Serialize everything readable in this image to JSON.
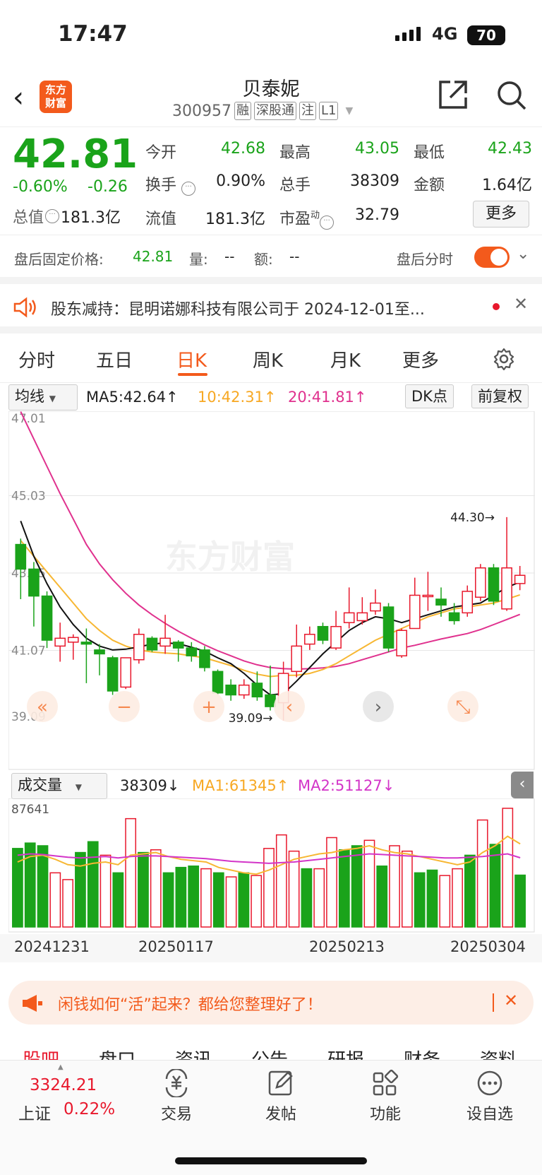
{
  "status": {
    "time": "17:47",
    "network": "4G",
    "battery": "70"
  },
  "header": {
    "logo": "东方\n财富",
    "title": "贝泰妮",
    "code": "300957",
    "tags": [
      "融",
      "深股通",
      "注",
      "L1"
    ]
  },
  "quote": {
    "price": "42.81",
    "pct": "-0.60%",
    "change": "-0.26",
    "open_l": "今开",
    "open_v": "42.68",
    "high_l": "最高",
    "high_v": "43.05",
    "low_l": "最低",
    "low_v": "42.43",
    "turn_l": "换手",
    "turn_v": "0.90%",
    "vol_l": "总手",
    "vol_v": "38309",
    "amt_l": "金额",
    "amt_v": "1.64亿",
    "mcap_l": "总值",
    "mcap_v": "181.3亿",
    "fcap_l": "流值",
    "fcap_v": "181.3亿",
    "pe_l": "市盈",
    "pe_sup": "动",
    "pe_v": "32.79",
    "more": "更多"
  },
  "after": {
    "label": "盘后固定价格:",
    "price": "42.81",
    "vol_l": "量:",
    "vol_v": "--",
    "amt_l": "额:",
    "amt_v": "--",
    "toggle_l": "盘后分时"
  },
  "notice": {
    "text": "股东减持：昆明诺娜科技有限公司于 2024-12-01至..."
  },
  "tabs": [
    "分时",
    "五日",
    "日K",
    "周K",
    "月K",
    "更多"
  ],
  "ktool": {
    "select": "均线",
    "ma5": "MA5:42.64↑",
    "ma10": "10:42.31↑",
    "ma20": "20:41.81↑",
    "dk": "DK点",
    "fq": "前复权"
  },
  "vtool": {
    "select": "成交量",
    "vol": "38309↓",
    "ma1": "MA1:61345↑",
    "ma2": "MA2:51127↓",
    "vmax": "87641"
  },
  "chart_data": {
    "type": "candlestick",
    "ylim": [
      39.09,
      47.01
    ],
    "yticks": [
      "47.01",
      "45.03",
      "43.05",
      "41.07",
      "39.09"
    ],
    "high_mark": "44.30",
    "low_mark": "39.09",
    "candles": [
      {
        "o": 43.6,
        "c": 42.97,
        "h": 43.75,
        "l": 42.2
      },
      {
        "o": 42.97,
        "c": 42.28,
        "h": 43.15,
        "l": 41.5
      },
      {
        "o": 42.28,
        "c": 41.15,
        "h": 42.4,
        "l": 40.95
      },
      {
        "o": 41.0,
        "c": 41.2,
        "h": 41.6,
        "l": 40.6
      },
      {
        "o": 41.1,
        "c": 41.22,
        "h": 41.3,
        "l": 40.65
      },
      {
        "o": 41.1,
        "c": 41.05,
        "h": 41.45,
        "l": 40.05
      },
      {
        "o": 40.9,
        "c": 40.8,
        "h": 41.05,
        "l": 40.25
      },
      {
        "o": 40.7,
        "c": 39.85,
        "h": 40.75,
        "l": 39.75
      },
      {
        "o": 39.95,
        "c": 40.7,
        "h": 40.7,
        "l": 39.9
      },
      {
        "o": 40.65,
        "c": 41.3,
        "h": 41.45,
        "l": 40.55
      },
      {
        "o": 41.2,
        "c": 40.9,
        "h": 41.25,
        "l": 40.85
      },
      {
        "o": 41.0,
        "c": 41.2,
        "h": 41.8,
        "l": 40.8
      },
      {
        "o": 41.1,
        "c": 40.95,
        "h": 41.15,
        "l": 40.6
      },
      {
        "o": 40.95,
        "c": 40.75,
        "h": 41.1,
        "l": 40.6
      },
      {
        "o": 40.9,
        "c": 40.45,
        "h": 41.0,
        "l": 40.35
      },
      {
        "o": 40.35,
        "c": 39.8,
        "h": 40.4,
        "l": 39.75
      },
      {
        "o": 40.0,
        "c": 39.75,
        "h": 40.15,
        "l": 39.6
      },
      {
        "o": 39.75,
        "c": 40.0,
        "h": 40.15,
        "l": 39.65
      },
      {
        "o": 40.05,
        "c": 39.7,
        "h": 40.35,
        "l": 39.6
      },
      {
        "o": 39.75,
        "c": 39.45,
        "h": 40.5,
        "l": 39.35
      },
      {
        "o": 39.55,
        "c": 40.3,
        "h": 40.6,
        "l": 39.09
      },
      {
        "o": 40.35,
        "c": 41.0,
        "h": 41.55,
        "l": 40.2
      },
      {
        "o": 41.05,
        "c": 41.3,
        "h": 41.5,
        "l": 40.9
      },
      {
        "o": 41.5,
        "c": 41.15,
        "h": 41.6,
        "l": 41.05
      },
      {
        "o": 40.95,
        "c": 41.5,
        "h": 41.9,
        "l": 40.9
      },
      {
        "o": 41.6,
        "c": 41.85,
        "h": 42.5,
        "l": 41.45
      },
      {
        "o": 41.65,
        "c": 41.85,
        "h": 42.25,
        "l": 41.55
      },
      {
        "o": 41.9,
        "c": 42.1,
        "h": 42.45,
        "l": 41.8
      },
      {
        "o": 42.0,
        "c": 40.95,
        "h": 42.1,
        "l": 40.85
      },
      {
        "o": 40.75,
        "c": 41.4,
        "h": 41.45,
        "l": 40.7
      },
      {
        "o": 41.45,
        "c": 42.3,
        "h": 42.75,
        "l": 41.45
      },
      {
        "o": 42.3,
        "c": 42.3,
        "h": 42.9,
        "l": 41.9
      },
      {
        "o": 42.2,
        "c": 42.05,
        "h": 42.5,
        "l": 41.75
      },
      {
        "o": 41.85,
        "c": 41.65,
        "h": 42.1,
        "l": 41.55
      },
      {
        "o": 41.85,
        "c": 42.4,
        "h": 42.55,
        "l": 41.75
      },
      {
        "o": 42.25,
        "c": 43.0,
        "h": 43.1,
        "l": 42.15
      },
      {
        "o": 43.0,
        "c": 42.15,
        "h": 43.1,
        "l": 42.05
      },
      {
        "o": 41.95,
        "c": 43.0,
        "h": 44.3,
        "l": 41.9
      },
      {
        "o": 42.6,
        "c": 42.81,
        "h": 43.05,
        "l": 42.43
      }
    ],
    "ma5": [
      44.2,
      43.3,
      42.6,
      42.0,
      41.55,
      41.2,
      41.0,
      40.9,
      40.92,
      40.98,
      41.05,
      41.08,
      41.06,
      40.97,
      40.87,
      40.7,
      40.55,
      40.3,
      40.0,
      39.75,
      39.78,
      40.1,
      40.45,
      40.8,
      41.1,
      41.4,
      41.6,
      41.75,
      41.7,
      41.6,
      41.7,
      41.8,
      41.9,
      42.0,
      42.05,
      42.1,
      42.3,
      42.5,
      42.64
    ],
    "ma10": [
      43.7,
      43.3,
      42.9,
      42.5,
      42.1,
      41.7,
      41.4,
      41.15,
      41.0,
      40.9,
      40.85,
      40.82,
      40.8,
      40.75,
      40.7,
      40.6,
      40.5,
      40.38,
      40.28,
      40.22,
      40.25,
      40.25,
      40.3,
      40.4,
      40.55,
      40.75,
      40.95,
      41.15,
      41.3,
      41.45,
      41.6,
      41.75,
      41.85,
      41.95,
      42.0,
      42.05,
      42.1,
      42.2,
      42.31
    ],
    "ma20": [
      47.0,
      46.3,
      45.6,
      44.9,
      44.25,
      43.6,
      43.1,
      42.7,
      42.35,
      42.05,
      41.8,
      41.58,
      41.38,
      41.2,
      41.03,
      40.88,
      40.75,
      40.62,
      40.52,
      40.45,
      40.42,
      40.41,
      40.42,
      40.44,
      40.48,
      40.55,
      40.65,
      40.75,
      40.85,
      40.95,
      41.02,
      41.1,
      41.18,
      41.25,
      41.32,
      41.42,
      41.55,
      41.68,
      41.81
    ],
    "volumes": [
      58000,
      62000,
      60000,
      40000,
      35000,
      55000,
      63000,
      53000,
      40000,
      80000,
      55000,
      57000,
      40000,
      44000,
      45000,
      43000,
      40000,
      37000,
      40000,
      38000,
      58000,
      68000,
      56000,
      43000,
      43000,
      66000,
      57000,
      60000,
      64000,
      45000,
      60000,
      56000,
      40000,
      42000,
      38000,
      43000,
      53000,
      79000,
      61000,
      87641,
      38309
    ],
    "vol_up": [
      false,
      false,
      false,
      true,
      true,
      false,
      false,
      true,
      false,
      true,
      false,
      true,
      false,
      false,
      false,
      true,
      false,
      true,
      false,
      true,
      true,
      true,
      true,
      false,
      true,
      true,
      false,
      false,
      true,
      false,
      true,
      true,
      false,
      false,
      true,
      true,
      false,
      true,
      false,
      true,
      false
    ],
    "vma1": [
      48000,
      52000,
      53000,
      50000,
      46000,
      45000,
      47000,
      48000,
      46000,
      53000,
      54000,
      55000,
      52000,
      50000,
      49000,
      48000,
      44000,
      42000,
      40000,
      39000,
      42000,
      46000,
      50000,
      52000,
      54000,
      55000,
      57000,
      58000,
      60000,
      57000,
      55000,
      54000,
      52000,
      50000,
      48000,
      46000,
      48000,
      55000,
      60000,
      67000,
      61345
    ],
    "vma2": [
      53000,
      54000,
      53500,
      52500,
      51500,
      51000,
      51500,
      52000,
      51000,
      52000,
      52500,
      52500,
      52000,
      51500,
      51000,
      50500,
      49500,
      48500,
      48000,
      47500,
      47000,
      47500,
      48000,
      49000,
      50000,
      51000,
      52000,
      53000,
      54000,
      53500,
      53000,
      52500,
      52000,
      51500,
      51000,
      51000,
      51500,
      52000,
      53000,
      54000,
      51127
    ],
    "dates": [
      "20241231",
      "20250117",
      "20250213",
      "20250304"
    ]
  },
  "promo": {
    "text": "闲钱如何“活”起来？都给您整理好了！"
  },
  "subtabs": [
    "股吧",
    "盘口",
    "资讯",
    "公告",
    "研报",
    "财务",
    "资料"
  ],
  "bottom": {
    "index_v": "3324.21",
    "index_l": "上证",
    "index_pct": "0.22%",
    "items": [
      "交易",
      "发帖",
      "功能",
      "设自选"
    ]
  }
}
